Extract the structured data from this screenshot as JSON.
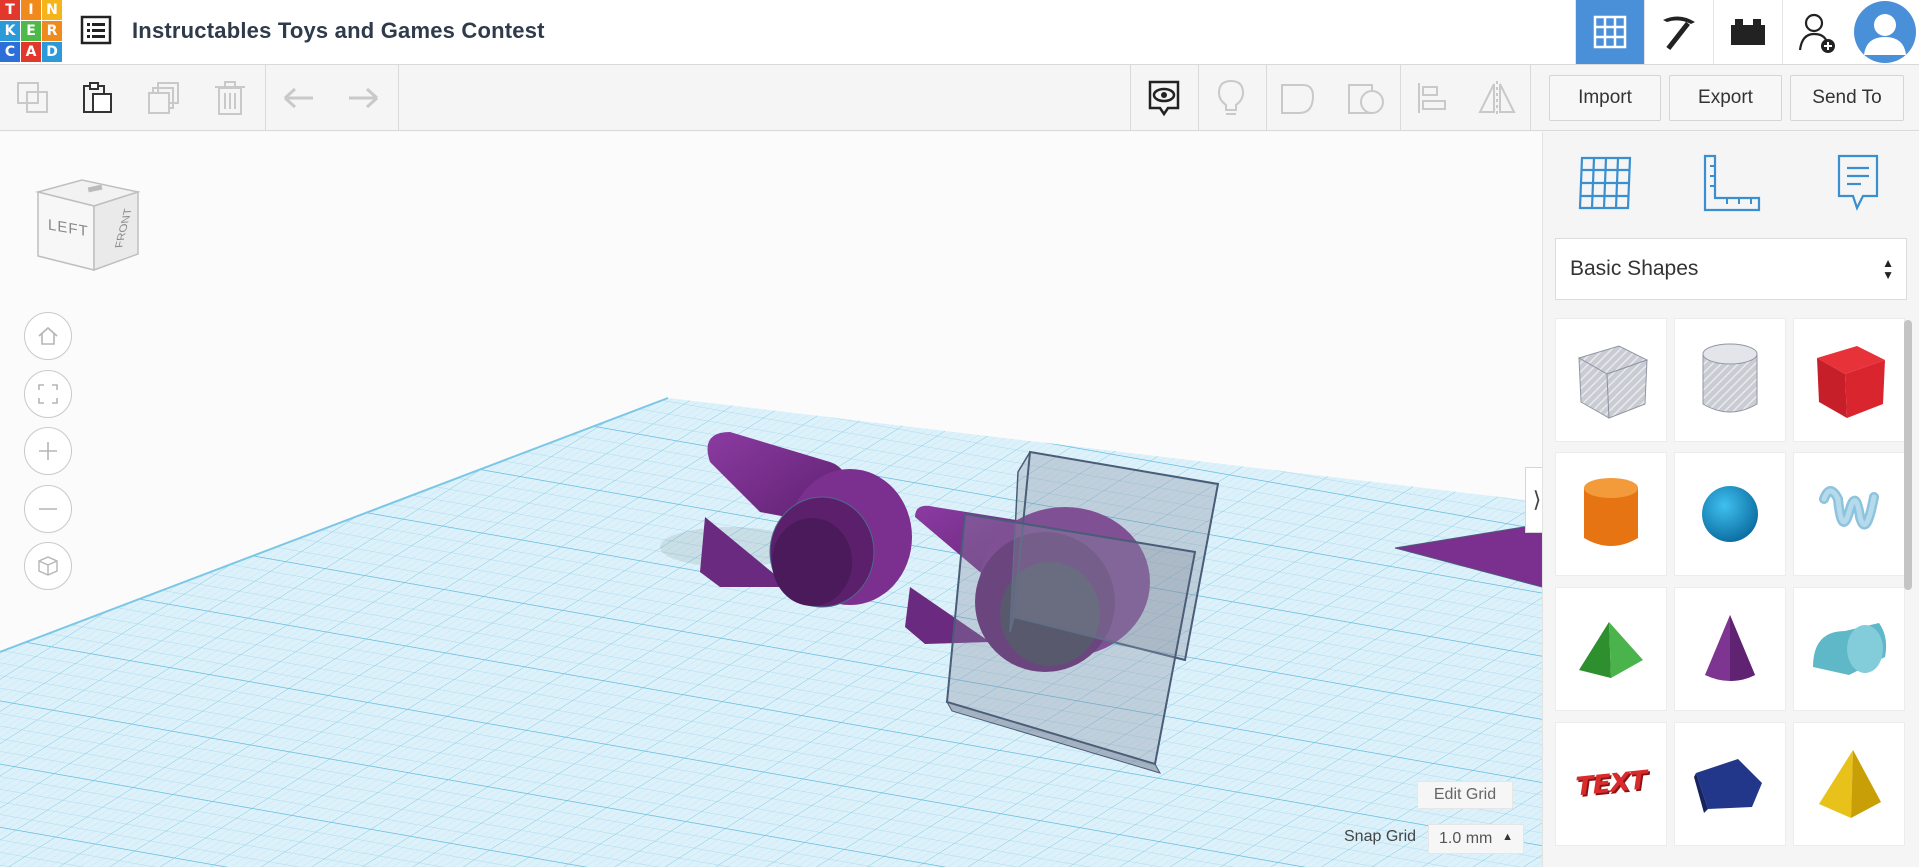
{
  "app": {
    "logo_letters": [
      "T",
      "I",
      "N",
      "K",
      "E",
      "R",
      "C",
      "A",
      "D"
    ],
    "logo_colors": [
      "#e2382b",
      "#f08a1d",
      "#f5b41a",
      "#2c9ad8",
      "#4fb84a",
      "#f08a1d",
      "#2c6fd8",
      "#e2382b",
      "#2c9ad8"
    ],
    "design_title": "Instructables Toys and Games Contest"
  },
  "topbar": {
    "icons": [
      "3d-design-grid-icon",
      "circuits-pickaxe-icon",
      "codeblocks-brick-icon",
      "invite-user-icon",
      "avatar"
    ]
  },
  "toolbar": {
    "import_label": "Import",
    "export_label": "Export",
    "send_to_label": "Send To"
  },
  "view_cube": {
    "left_label": "LEFT",
    "front_label": "FRONT"
  },
  "workplane": {
    "edit_grid_label": "Edit Grid",
    "snap_grid_label": "Snap Grid",
    "snap_grid_value": "1.0 mm",
    "grid_color": "#9fd4ea",
    "plane_color": "#dcf1fa",
    "object_color": "#7b2f8f"
  },
  "panel": {
    "category_value": "Basic Shapes",
    "shapes": [
      {
        "name": "Box (hole)",
        "icon": "box-hole-icon"
      },
      {
        "name": "Cylinder (hole)",
        "icon": "cylinder-hole-icon"
      },
      {
        "name": "Box",
        "icon": "box-icon"
      },
      {
        "name": "Cylinder",
        "icon": "cylinder-icon"
      },
      {
        "name": "Sphere",
        "icon": "sphere-icon"
      },
      {
        "name": "Scribble",
        "icon": "scribble-icon"
      },
      {
        "name": "Roof",
        "icon": "roof-icon"
      },
      {
        "name": "Cone",
        "icon": "cone-icon"
      },
      {
        "name": "Round Roof",
        "icon": "round-roof-icon"
      },
      {
        "name": "Text",
        "icon": "text-icon",
        "text": "TEXT"
      },
      {
        "name": "Polygon",
        "icon": "polygon-icon"
      },
      {
        "name": "Pyramid",
        "icon": "pyramid-icon"
      }
    ]
  }
}
